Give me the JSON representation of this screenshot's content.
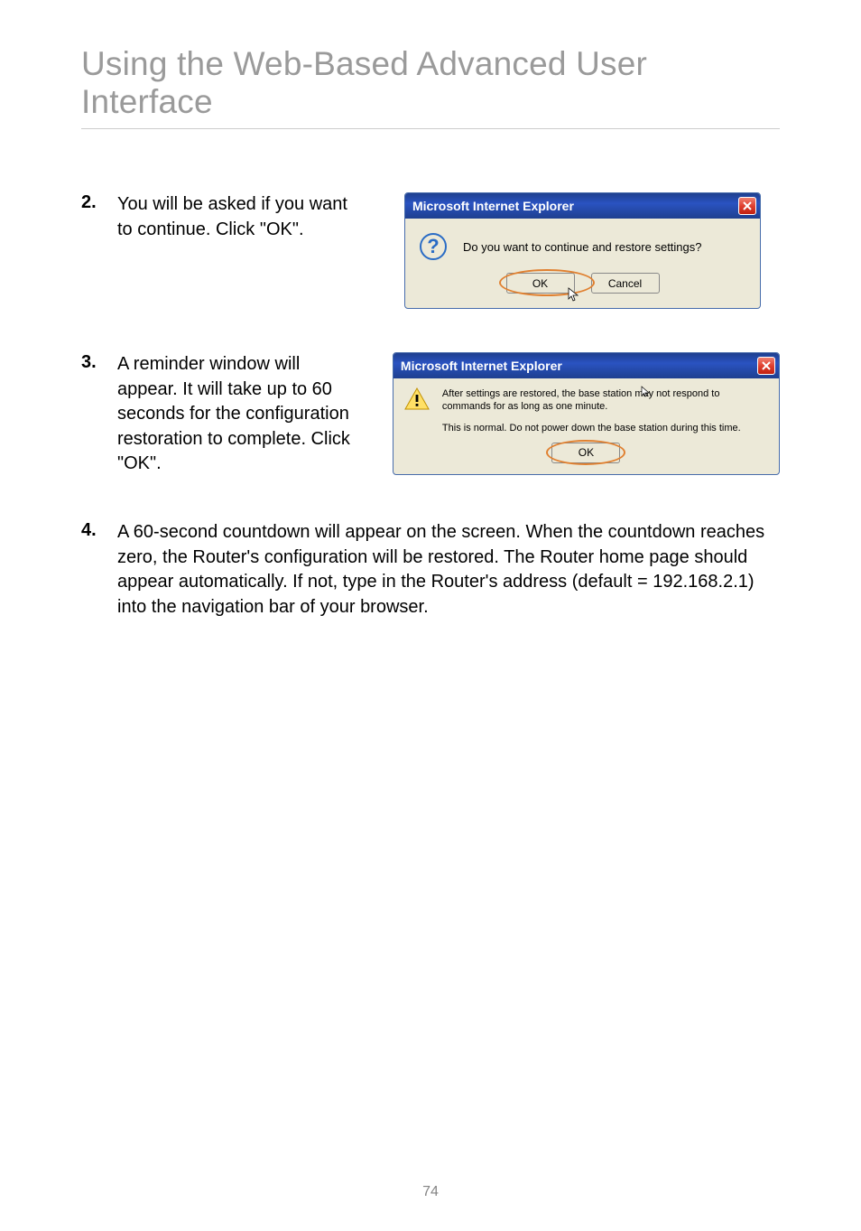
{
  "page": {
    "title": "Using the Web-Based Advanced User Interface",
    "page_number": "74"
  },
  "steps": {
    "s2": {
      "num": "2.",
      "text": "You will be asked if you want to continue. Click \"OK\"."
    },
    "s3": {
      "num": "3.",
      "text": "A reminder window will appear. It will take up to 60 seconds for the configuration restoration to complete. Click \"OK\"."
    },
    "s4": {
      "num": "4.",
      "text": "A 60-second countdown will appear on the screen. When the countdown reaches zero, the Router's configuration will be restored. The Router home page should appear automatically. If not, type in the Router's address (default = 192.168.2.1) into the navigation bar of your browser."
    }
  },
  "dialog1": {
    "title": "Microsoft Internet Explorer",
    "message": "Do you want to continue and restore settings?",
    "ok": "OK",
    "cancel": "Cancel",
    "question": "?"
  },
  "dialog2": {
    "title": "Microsoft Internet Explorer",
    "msg_line1": "After settings are restored, the base station may not respond to commands for as long as one minute.",
    "msg_line2": "This is normal. Do not power down the base station during this time.",
    "ok": "OK"
  }
}
